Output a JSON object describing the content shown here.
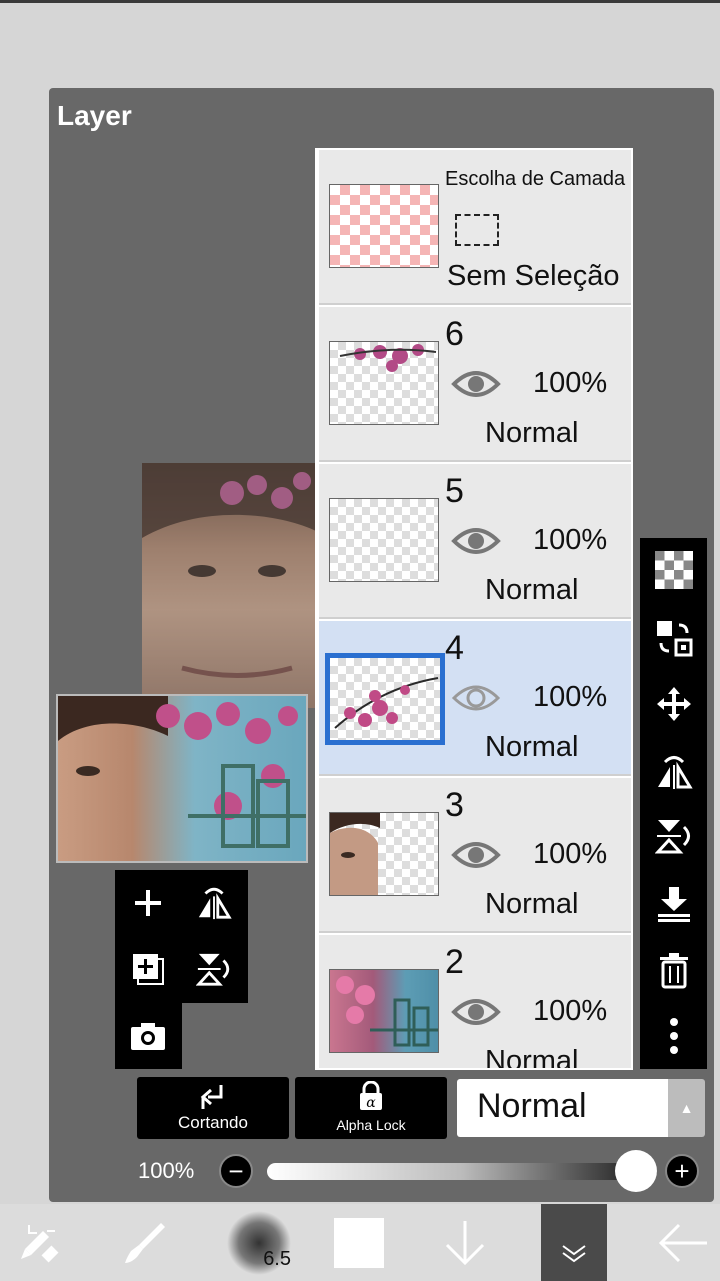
{
  "panel": {
    "title": "Layer"
  },
  "selection_row": {
    "title": "Escolha de Camada",
    "status": "Sem Seleção"
  },
  "layers": [
    {
      "number": "6",
      "opacity": "100%",
      "blend": "Normal",
      "selected": false
    },
    {
      "number": "5",
      "opacity": "100%",
      "blend": "Normal",
      "selected": false
    },
    {
      "number": "4",
      "opacity": "100%",
      "blend": "Normal",
      "selected": true
    },
    {
      "number": "3",
      "opacity": "100%",
      "blend": "Normal",
      "selected": false
    },
    {
      "number": "2",
      "opacity": "100%",
      "blend": "Normal",
      "selected": false
    }
  ],
  "buttons": {
    "clipping": "Cortando",
    "alpha_lock": "Alpha Lock"
  },
  "blend_mode": {
    "value": "Normal"
  },
  "opacity": {
    "label": "100%",
    "value": 1.0
  },
  "brush": {
    "size": "6.5"
  },
  "icons": {
    "right_toolbar": [
      "checker-icon",
      "transform-swap-icon",
      "move-icon",
      "flip-horizontal-icon",
      "flip-vertical-icon",
      "merge-down-icon",
      "trash-icon",
      "more-icon"
    ],
    "left_toolbar": [
      "add-layer-icon",
      "flip-horizontal-icon",
      "add-layer-copy-icon",
      "flip-vertical-icon",
      "camera-icon"
    ],
    "bottom_bar": [
      "tool-swap-icon",
      "brush-icon",
      "brush-size-icon",
      "color-swatch-icon",
      "down-arrow-icon",
      "layer-menu-icon",
      "back-arrow-icon"
    ]
  },
  "colors": {
    "selection_blue": "#2a6fd0",
    "panel_gray": "#686868"
  }
}
